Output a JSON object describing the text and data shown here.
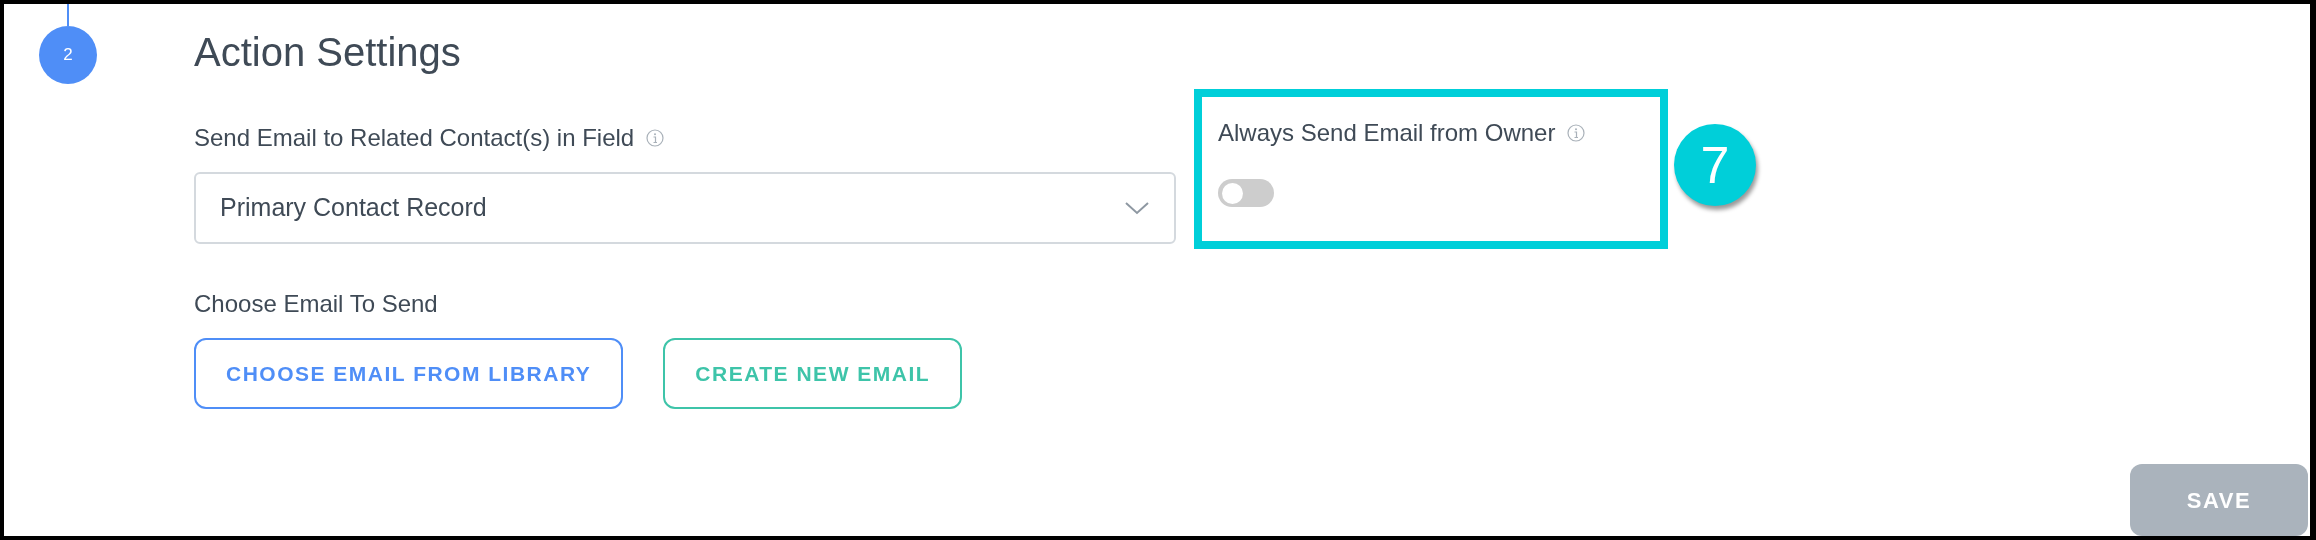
{
  "step": {
    "number": "2"
  },
  "title": "Action Settings",
  "related_field": {
    "label": "Send Email to Related Contact(s) in Field",
    "value": "Primary Contact Record"
  },
  "email_choice": {
    "label": "Choose Email To Send",
    "buttons": [
      {
        "label": "CHOOSE EMAIL FROM LIBRARY",
        "kind": "primary"
      },
      {
        "label": "CREATE NEW EMAIL",
        "kind": "secondary"
      }
    ]
  },
  "owner_setting": {
    "label": "Always Send Email from Owner",
    "on": false,
    "highlighted": true
  },
  "callout": {
    "number": "7"
  },
  "save_button": {
    "label": "SAVE",
    "disabled": true
  }
}
